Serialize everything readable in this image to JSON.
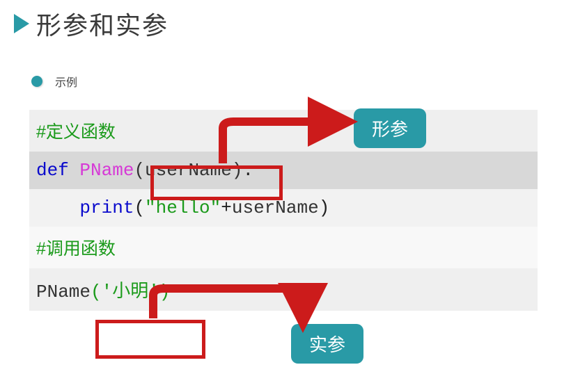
{
  "header": {
    "title": "形参和实参"
  },
  "sub": {
    "label": "示例"
  },
  "callouts": {
    "param": "形参",
    "arg": "实参"
  },
  "code": {
    "l1_comment": "#定义函数",
    "l2_def": "def",
    "l2_fname": "PName",
    "l2_open": "(",
    "l2_param": "userName",
    "l2_close": ")",
    "l2_colon": ":",
    "l3_indent": "    ",
    "l3_print": "print",
    "l3_open": "(",
    "l3_str": "\"hello\"",
    "l3_plus": "+",
    "l3_ident": "userName",
    "l3_close": ")",
    "l4_comment": "#调用函数",
    "l5_call": "PName",
    "l5_open": "(",
    "l5_arg": "'小明'",
    "l5_close": ")"
  }
}
